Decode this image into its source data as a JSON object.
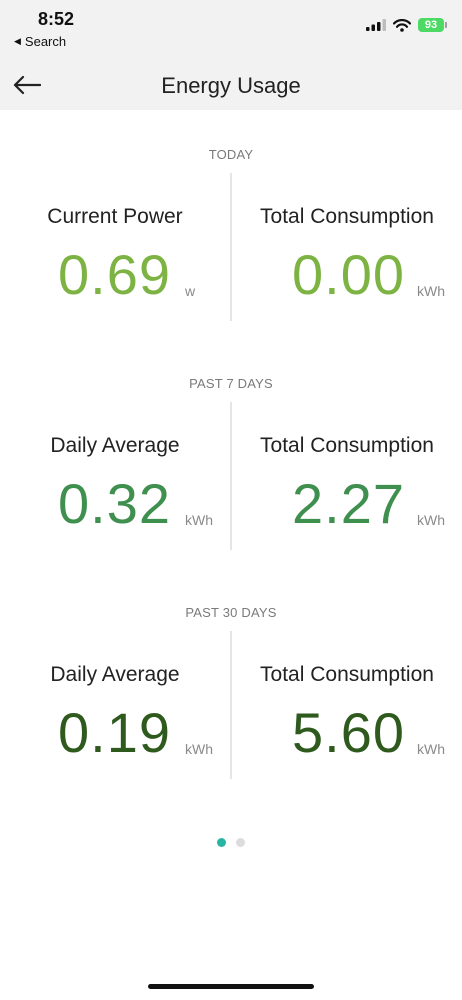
{
  "status_bar": {
    "time": "8:52",
    "back_label": "Search",
    "battery": "93"
  },
  "nav": {
    "title": "Energy Usage"
  },
  "sections": [
    {
      "label": "TODAY",
      "left": {
        "label": "Current Power",
        "value": "0.69",
        "unit": "w"
      },
      "right": {
        "label": "Total Consumption",
        "value": "0.00",
        "unit": "kWh"
      }
    },
    {
      "label": "PAST 7 DAYS",
      "left": {
        "label": "Daily Average",
        "value": "0.32",
        "unit": "kWh"
      },
      "right": {
        "label": "Total Consumption",
        "value": "2.27",
        "unit": "kWh"
      }
    },
    {
      "label": "PAST 30 DAYS",
      "left": {
        "label": "Daily Average",
        "value": "0.19",
        "unit": "kWh"
      },
      "right": {
        "label": "Total Consumption",
        "value": "5.60",
        "unit": "kWh"
      }
    }
  ],
  "pager": {
    "pages": 2,
    "active": 1
  },
  "colors": {
    "today_value": "#7cb342",
    "week_value": "#3f8f4f",
    "month_value": "#2f5a1e",
    "pager_active": "#26b5a3"
  }
}
